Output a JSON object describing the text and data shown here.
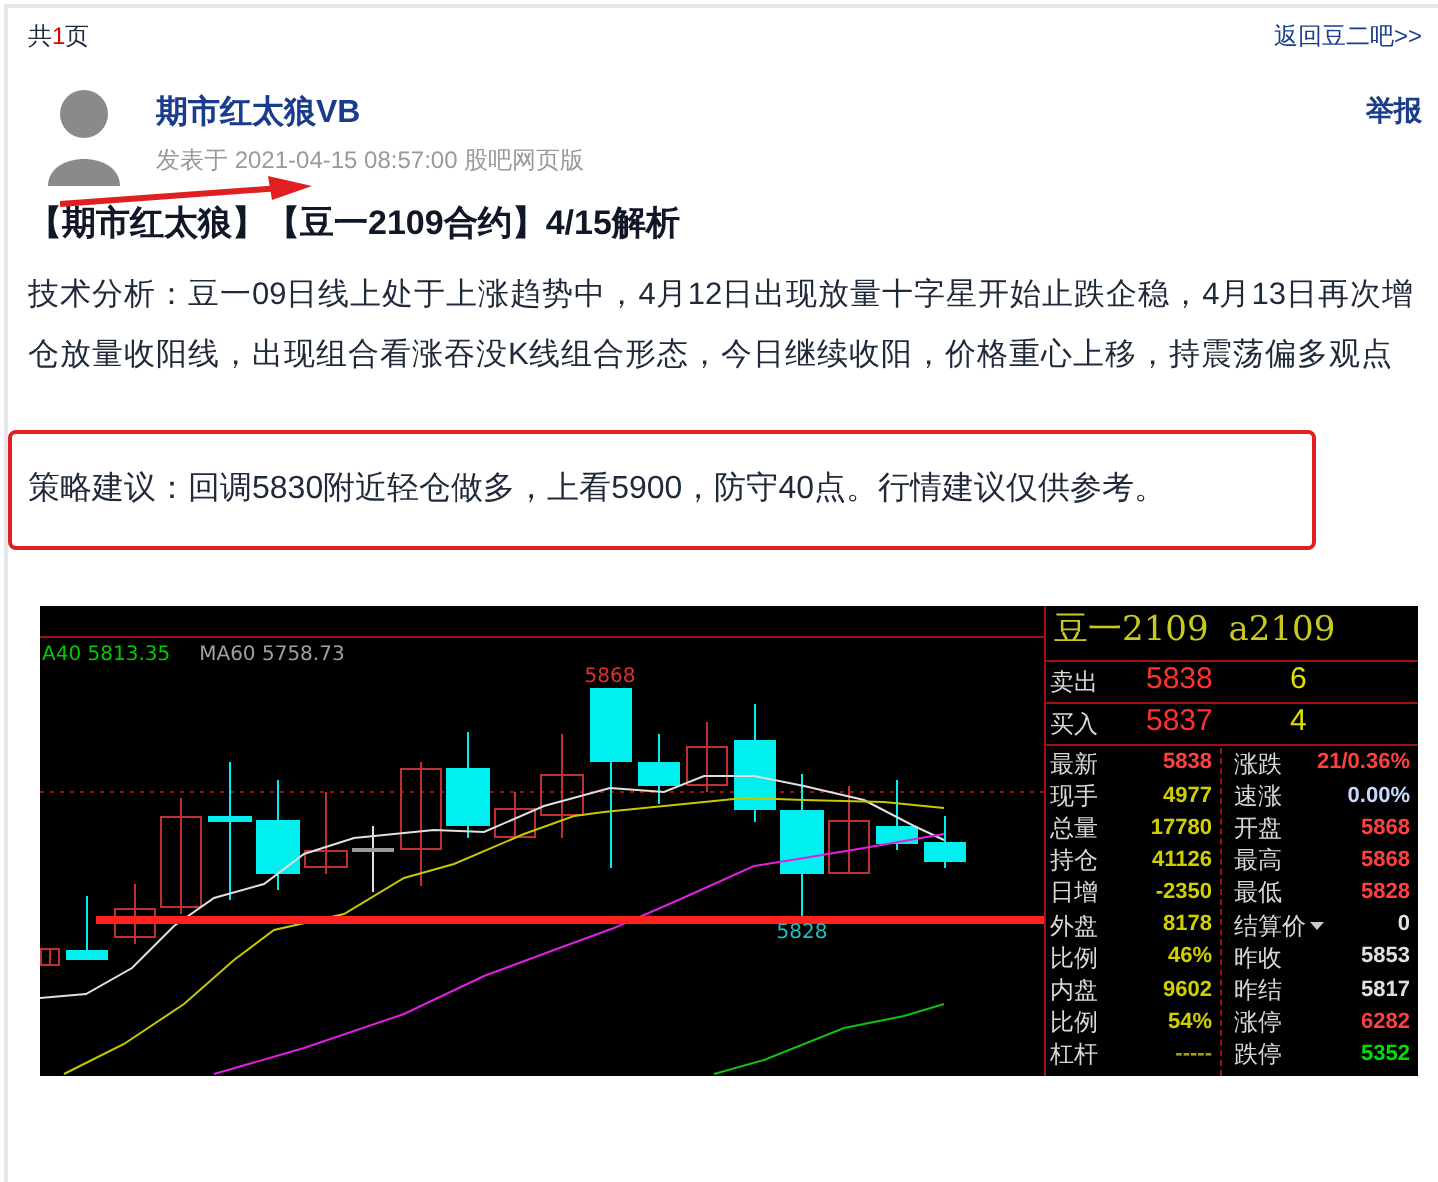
{
  "pager": {
    "prefix": "共",
    "count": "1",
    "suffix": "页"
  },
  "back_link": "返回豆二吧>>",
  "post": {
    "author": "期市红太狼VB",
    "report": "举报",
    "meta": "发表于 2021-04-15 08:57:00 股吧网页版",
    "title": "【期市红太狼】【豆一2109合约】4/15解析",
    "body": "技术分析：豆一09日线上处于上涨趋势中，4月12日出现放量十字星开始止跌企稳，4月13日再次增仓放量收阳线，出现组合看涨吞没K线组合形态，今日继续收阳，价格重心上移，持震荡偏多观点",
    "strategy": "策略建议：回调5830附近轻仓做多，上看5900，防守40点。行情建议仅供参考。"
  },
  "chart": {
    "legend": [
      {
        "text": "A40 5813.35",
        "color": "#00cc00"
      },
      {
        "text": "MA60 5758.73",
        "color": "#a0a0a0"
      }
    ],
    "high_label": "5868",
    "low_label": "5828"
  },
  "quote_panel": {
    "name": "豆一2109",
    "code": "a2109",
    "orders": [
      {
        "label": "卖出",
        "price": "5838",
        "volume": "6"
      },
      {
        "label": "买入",
        "price": "5837",
        "volume": "4"
      }
    ],
    "left_stats": [
      {
        "label": "最新",
        "value": "5838",
        "color": "#ff4040"
      },
      {
        "label": "现手",
        "value": "4977",
        "color": "#d0d000"
      },
      {
        "label": "总量",
        "value": "17780",
        "color": "#d0d000"
      },
      {
        "label": "持仓",
        "value": "41126",
        "color": "#d0d000"
      },
      {
        "label": "日增",
        "value": "-2350",
        "color": "#d0d000"
      },
      {
        "label": "外盘",
        "value": "8178",
        "color": "#d0d000"
      },
      {
        "label": "比例",
        "value": "46%",
        "color": "#d0d000"
      },
      {
        "label": "内盘",
        "value": "9602",
        "color": "#d0d000"
      },
      {
        "label": "比例",
        "value": "54%",
        "color": "#d0d000"
      },
      {
        "label": "杠杆",
        "value": "-----",
        "color": "#a0a000"
      }
    ],
    "right_stats": [
      {
        "label": "涨跌",
        "value": "21/0.36%",
        "color": "#ff4040",
        "has_menu": false
      },
      {
        "label": "速涨",
        "value": "0.00%",
        "color": "#c8d8ff",
        "has_menu": false
      },
      {
        "label": "开盘",
        "value": "5868",
        "color": "#ff4040",
        "has_menu": false
      },
      {
        "label": "最高",
        "value": "5868",
        "color": "#ff4040",
        "has_menu": false
      },
      {
        "label": "最低",
        "value": "5828",
        "color": "#ff4040",
        "has_menu": false
      },
      {
        "label": "结算价",
        "value": "0",
        "color": "#e0e0e0",
        "has_menu": true
      },
      {
        "label": "昨收",
        "value": "5853",
        "color": "#e0e0e0",
        "has_menu": false
      },
      {
        "label": "昨结",
        "value": "5817",
        "color": "#e0e0e0",
        "has_menu": false
      },
      {
        "label": "涨停",
        "value": "6282",
        "color": "#ff4040",
        "has_menu": false
      },
      {
        "label": "跌停",
        "value": "5352",
        "color": "#00e000",
        "has_menu": false
      }
    ]
  }
}
